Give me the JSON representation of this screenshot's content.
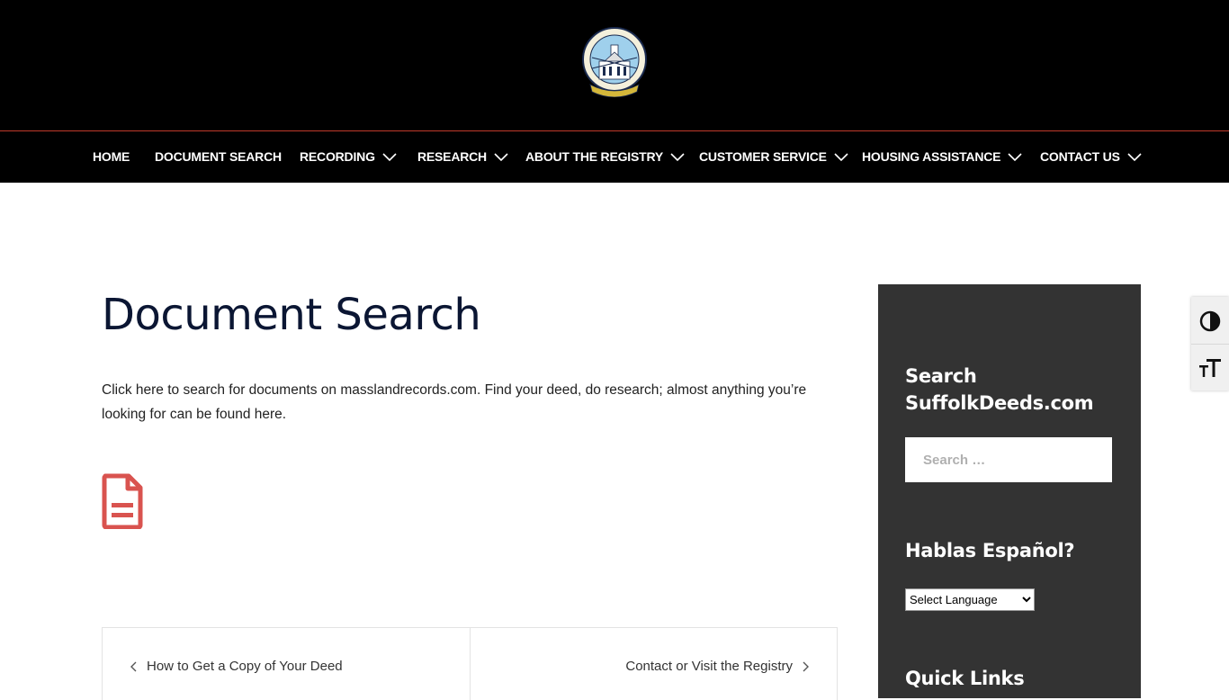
{
  "header": {
    "logo_icon": "registry-seal-logo",
    "logo_text": "SUFFOLK REGISTRY OF DEEDS - BOSTON - CHELSEA - REVERE - WINTHROP - 1639"
  },
  "nav": {
    "items": [
      {
        "label": "HOME",
        "has_dropdown": false
      },
      {
        "label": "DOCUMENT SEARCH",
        "has_dropdown": false
      },
      {
        "label": "RECORDING",
        "has_dropdown": true
      },
      {
        "label": "RESEARCH",
        "has_dropdown": true
      },
      {
        "label": "ABOUT THE REGISTRY",
        "has_dropdown": true
      },
      {
        "label": "CUSTOMER SERVICE",
        "has_dropdown": true
      },
      {
        "label": "HOUSING ASSISTANCE",
        "has_dropdown": true
      },
      {
        "label": "CONTACT US",
        "has_dropdown": true
      }
    ]
  },
  "main": {
    "title": "Document Search",
    "intro": "Click here to search for documents on masslandrecords.com. Find your deed, do research; almost anything you’re looking for can be found here.",
    "doc_icon": "document-icon",
    "post_nav": {
      "prev": "How to Get a Copy of Your Deed",
      "next": "Contact or Visit the Registry"
    }
  },
  "sidebar": {
    "search_title": "Search SuffolkDeeds.com",
    "search_placeholder": "Search …",
    "language_title": "Hablas Español?",
    "language_select": "Select Language",
    "quick_links_title": "Quick Links"
  },
  "colors": {
    "header_bg": "#000000",
    "divider": "#c0392b",
    "title": "#0b1633",
    "doc_icon": "#d9534f",
    "sidebar_bg": "#333333"
  }
}
